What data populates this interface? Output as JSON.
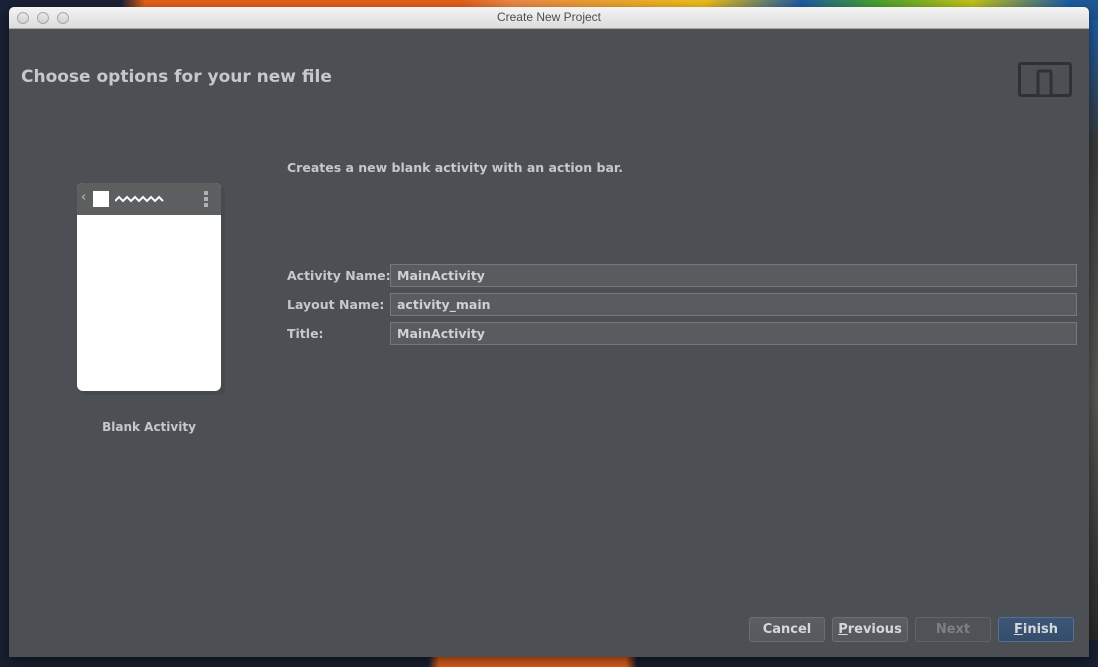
{
  "window": {
    "title": "Create New Project"
  },
  "header": {
    "title": "Choose options for your new file",
    "device_icon": "phone-tablet-icon"
  },
  "template_preview": {
    "label": "Blank Activity",
    "icons": [
      "back-chevron-icon",
      "app-logo-icon",
      "overflow-menu-icon"
    ]
  },
  "description": "Creates a new blank activity with an action bar.",
  "form": {
    "fields": [
      {
        "label": "Activity Name:",
        "value": "MainActivity"
      },
      {
        "label": "Layout Name:",
        "value": "activity_main"
      },
      {
        "label": "Title:",
        "value": "MainActivity"
      }
    ]
  },
  "buttons": {
    "cancel": "Cancel",
    "previous_mnemonic": "P",
    "previous_rest": "revious",
    "next": "Next",
    "finish_mnemonic": "F",
    "finish_rest": "inish"
  },
  "colors": {
    "content_bg": "#4c5054",
    "text": "#c5c8cc",
    "finish_accent": "#3d5677"
  }
}
